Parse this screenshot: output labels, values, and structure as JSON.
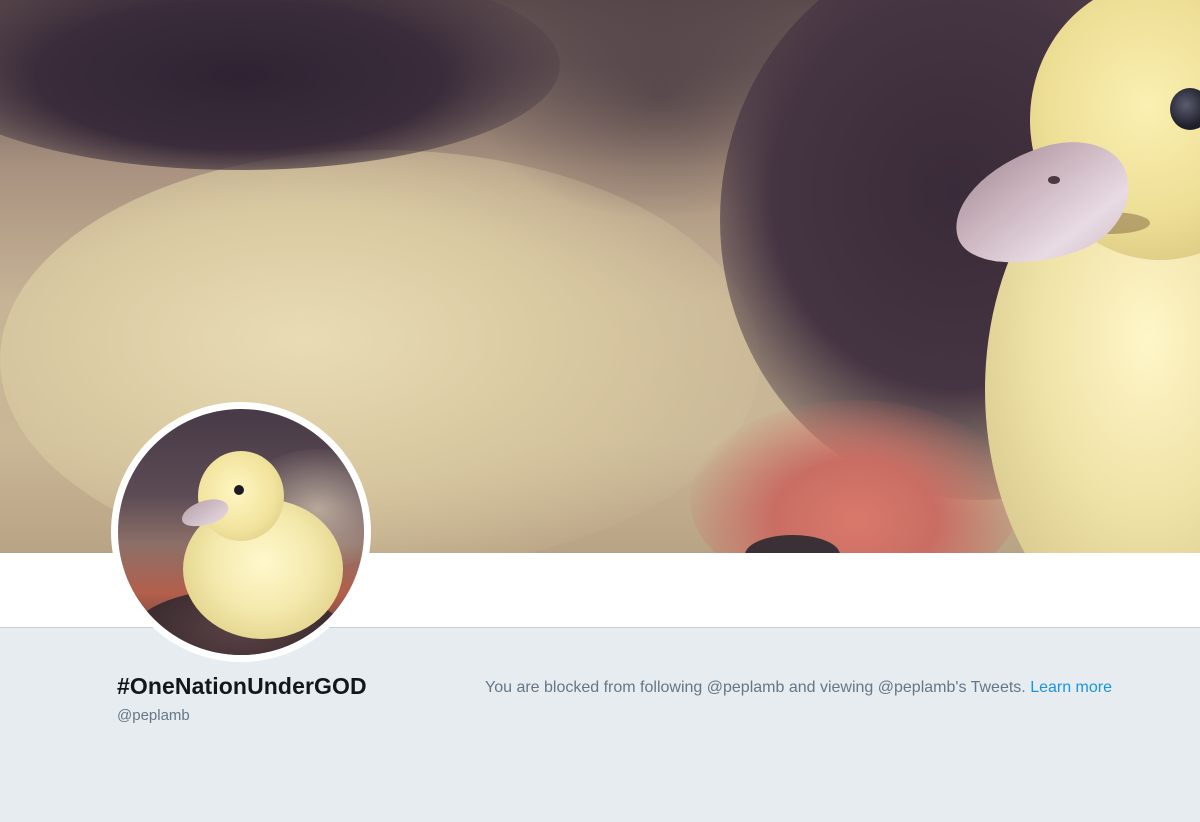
{
  "profile": {
    "display_name": "#OneNationUnderGOD",
    "handle": "@peplamb"
  },
  "blocked_notice": {
    "message": "You are blocked from following @peplamb and viewing @peplamb's Tweets.",
    "link_label": "Learn more"
  },
  "colors": {
    "page_background": "#e6ecf0",
    "name_text": "#14171a",
    "secondary_text": "#657786",
    "link": "#1b95e0"
  }
}
